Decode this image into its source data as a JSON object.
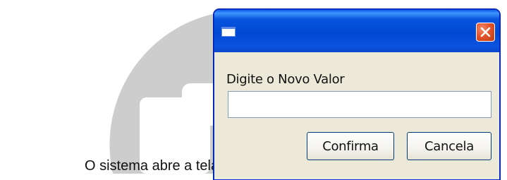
{
  "caption": "O sistema abre a tela",
  "dialog": {
    "title": "",
    "close_icon": "close-icon",
    "prompt": "Digite o Novo Valor",
    "input_value": "",
    "confirm_label": "Confirma",
    "cancel_label": "Cancela"
  },
  "colors": {
    "titlebar": "#0855dd",
    "dialog_body": "#ece9d8",
    "close_button": "#e3542b",
    "watermark": "#c9c9c9"
  }
}
